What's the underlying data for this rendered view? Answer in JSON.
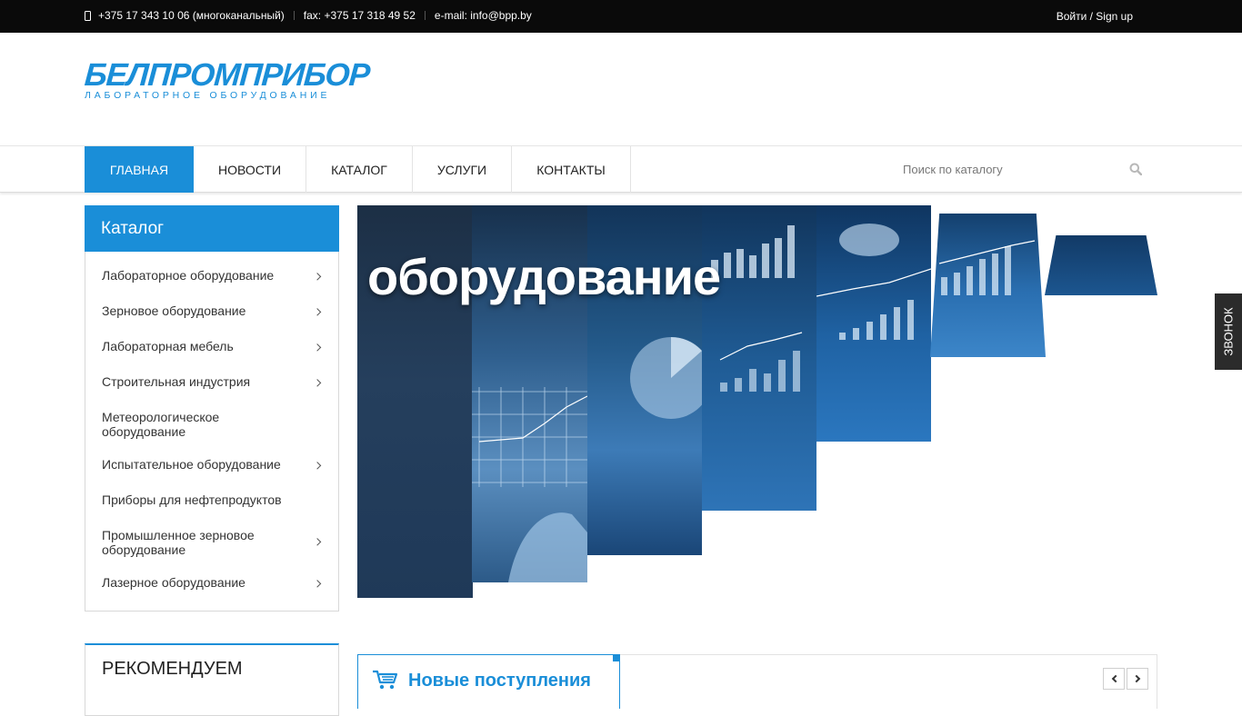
{
  "topbar": {
    "phone": "+375 17 343 10 06 (многоканальный)",
    "fax": "fax: +375 17 318 49 52",
    "email": "e-mail: info@bpp.by",
    "login_label": "Войти /",
    "signup_label": "Sign up"
  },
  "logo": {
    "main": "БЕЛПРОМПРИБОР",
    "sub": "ЛАБОРАТОРНОЕ ОБОРУДОВАНИЕ"
  },
  "nav": {
    "items": [
      {
        "label": "ГЛАВНАЯ",
        "active": true
      },
      {
        "label": "НОВОСТИ",
        "active": false
      },
      {
        "label": "КАТАЛОГ",
        "active": false
      },
      {
        "label": "УСЛУГИ",
        "active": false
      },
      {
        "label": "КОНТАКТЫ",
        "active": false
      }
    ],
    "search_placeholder": "Поиск по каталогу"
  },
  "catalog": {
    "title": "Каталог",
    "items": [
      {
        "label": "Лабораторное оборудование",
        "has_children": true
      },
      {
        "label": "Зерновое оборудование",
        "has_children": true
      },
      {
        "label": "Лабораторная мебель",
        "has_children": true
      },
      {
        "label": "Строительная индустрия",
        "has_children": true
      },
      {
        "label": "Метеорологическое оборудование",
        "has_children": false
      },
      {
        "label": "Испытательное оборудование",
        "has_children": true
      },
      {
        "label": "Приборы для нефтепродуктов",
        "has_children": false
      },
      {
        "label": "Промышленное зерновое оборудование",
        "has_children": true
      },
      {
        "label": "Лазерное оборудование",
        "has_children": true
      }
    ]
  },
  "recommend": {
    "title": "РЕКОМЕНДУЕМ"
  },
  "slider": {
    "title": "оборудование"
  },
  "new_arrivals": {
    "title": "Новые поступления"
  },
  "callback": {
    "label": "ЗВОНОК"
  },
  "colors": {
    "accent": "#1a8ed8",
    "topbar_bg": "#0a0a0a",
    "callback_bg": "#2b2b2b"
  }
}
